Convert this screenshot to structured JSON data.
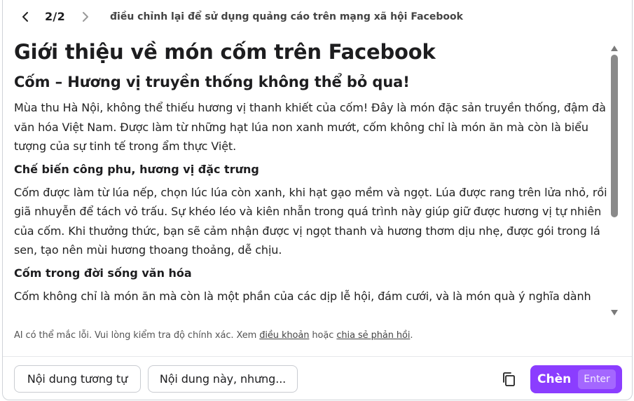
{
  "header": {
    "pager": "2/2",
    "title": "điều chỉnh lại để sử dụng quảng cáo trên mạng xã hội Facebook",
    "prev_icon": "chevron-left-icon",
    "next_icon": "chevron-right-icon"
  },
  "document": {
    "title": "Giới thiệu về món cốm trên Facebook",
    "subtitle": "Cốm – Hương vị truyền thống không thể bỏ qua!",
    "intro": "Mùa thu Hà Nội, không thể thiếu hương vị thanh khiết của cốm! Đây là món đặc sản truyền thống, đậm đà văn hóa Việt Nam. Được làm từ những hạt lúa non xanh mướt, cốm không chỉ là món ăn mà còn là biểu tượng của sự tinh tế trong ẩm thực Việt.",
    "section1_heading": "Chế biến công phu, hương vị đặc trưng",
    "section1_body": "Cốm được làm từ lúa nếp, chọn lúc lúa còn xanh, khi hạt gạo mềm và ngọt. Lúa được rang trên lửa nhỏ, rồi giã nhuyễn để tách vỏ trấu. Sự khéo léo và kiên nhẫn trong quá trình này giúp giữ được hương vị tự nhiên của cốm. Khi thưởng thức, bạn sẽ cảm nhận được vị ngọt thanh và hương thơm dịu nhẹ, được gói trong lá sen, tạo nên mùi hương thoang thoảng, dễ chịu.",
    "section2_heading": "Cốm trong đời sống văn hóa",
    "section2_body": "Cốm không chỉ là món ăn mà còn là một phần của các dịp lễ hội, đám cưới, và là món quà ý nghĩa dành"
  },
  "disclaimer": {
    "prefix": "AI có thể mắc lỗi. Vui lòng kiểm tra độ chính xác. Xem ",
    "terms_link": "điều khoản",
    "middle": " hoặc ",
    "feedback_link": "chia sẻ phản hồi",
    "suffix": "."
  },
  "footer": {
    "similar_label": "Nội dung tương tự",
    "variant_label": "Nội dung này, nhưng...",
    "copy_icon": "copy-icon",
    "insert_label": "Chèn",
    "insert_key": "Enter"
  },
  "colors": {
    "accent": "#8b3dff",
    "text": "#1d1d1f",
    "border": "#c9ccd1",
    "scroll_thumb": "#8a8a8a"
  }
}
